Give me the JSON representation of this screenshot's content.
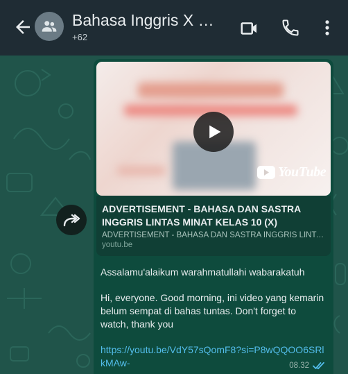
{
  "header": {
    "title": "Bahasa Inggris X OT...",
    "subtitle": "+62"
  },
  "icons": {
    "back": "arrow-left-icon",
    "avatar": "group-avatar-icon",
    "video_call": "video-camera-icon",
    "voice_call": "phone-icon",
    "menu": "kebab-menu-icon",
    "forward": "forward-arrow-icon",
    "play": "play-icon",
    "read": "double-check-icon"
  },
  "message": {
    "preview": {
      "logo_text": "YouTube"
    },
    "link_card": {
      "title": "ADVERTISEMENT - BAHASA DAN SASTRA INGGRIS LINTAS MINAT KELAS 10 (X)",
      "description": "ADVERTISEMENT - BAHASA DAN SASTRA INGGRIS LINTA...",
      "domain": "youtu.be"
    },
    "greeting": "Assalamu'alaikum warahmatullahi wabarakatuh",
    "body": "Hi, everyone. Good morning, ini video yang kemarin belum sempat di bahas tuntas. Don't forget to watch, thank you",
    "url": "https://youtu.be/VdY57sQomF8?si=P8wQQOO6SRlkMAw-",
    "time": "08.32"
  },
  "colors": {
    "header_bg": "#1f2c34",
    "chat_bg": "#20544a",
    "bubble_bg": "#0e4b3d",
    "link": "#53bdeb",
    "read_tick": "#53bdeb"
  }
}
